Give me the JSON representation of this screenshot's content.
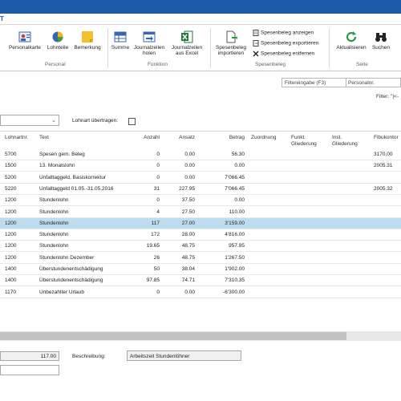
{
  "menubar": {
    "tab": "T"
  },
  "ribbon": {
    "groups": {
      "personal": "Personal",
      "funktion": "Funktion",
      "spesenbeleg": "Spesenbeleg",
      "seite": "Seite"
    },
    "buttons": {
      "personalkarte": "Personalkarte",
      "lohnteile": "Lohnteile",
      "bemerkung": "Bemerkung",
      "summe": "Summe",
      "journalzeilen_holen_1": "Journalzeilen",
      "journalzeilen_holen_2": "holen",
      "journalzeilen_excel_1": "Journalzeilen",
      "journalzeilen_excel_2": "aus Excel",
      "spesenbeleg_import_1": "Spesenbeleg",
      "spesenbeleg_import_2": "importieren",
      "spesenbeleg_anzeigen": "Spesenbeleg anzeigen",
      "spesenbeleg_exportieren": "Spesenbeleg exportieren",
      "spesenbeleg_entfernen": "Spesenbeleg entfernen",
      "aktualisieren": "Aktualisieren",
      "suchen": "Suchen"
    }
  },
  "filter": {
    "label": "Filtereingabe (F3)",
    "field": "Personalnr.",
    "status": "Filter: \"|<-"
  },
  "options": {
    "lohnart_label": "Lohnart übertragen:"
  },
  "table": {
    "headers": {
      "lohnartnr": "Lohnartnr.",
      "text": "Text",
      "anzahl": "Anzahl",
      "ansatz": "Ansatz",
      "betrag": "Betrag",
      "zuordnung": "Zuordnung",
      "funkt_1": "Funkt.",
      "funkt_2": "Gliederung",
      "inst_1": "Inst.",
      "inst_2": "Gliederung",
      "fibu": "Fibukontor"
    },
    "rows": [
      {
        "nr": "5700",
        "text": "Spesen gem. Beleg",
        "anzahl": "0",
        "ansatz": "0.00",
        "betrag": "56.30",
        "fibu": "3170.00"
      },
      {
        "nr": "1500",
        "text": "13. Monatslohn",
        "anzahl": "0",
        "ansatz": "0.00",
        "betrag": "0.00",
        "fibu": "2005.31"
      },
      {
        "nr": "5200",
        "text": "Unfalltaggeld, Basiskorrektur",
        "anzahl": "0",
        "ansatz": "0.00",
        "betrag": "7'066.45",
        "fibu": ""
      },
      {
        "nr": "5220",
        "text": "Unfalltaggeld 01.05.-31.05.2016",
        "anzahl": "31",
        "ansatz": "227.95",
        "betrag": "7'066.45",
        "fibu": "2005.32"
      },
      {
        "nr": "1200",
        "text": "Stundenlohn",
        "anzahl": "0",
        "ansatz": "37.50",
        "betrag": "0.00",
        "fibu": ""
      },
      {
        "nr": "1200",
        "text": "Stundenlohn",
        "anzahl": "4",
        "ansatz": "27.50",
        "betrag": "110.00",
        "fibu": ""
      },
      {
        "nr": "1200",
        "text": "Stundenlohn",
        "anzahl": "117",
        "ansatz": "27.00",
        "betrag": "3'159.00",
        "fibu": ""
      },
      {
        "nr": "1200",
        "text": "Stundenlohn",
        "anzahl": "172",
        "ansatz": "28.00",
        "betrag": "4'816.00",
        "fibu": ""
      },
      {
        "nr": "1200",
        "text": "Stundenlohn",
        "anzahl": "19.65",
        "ansatz": "48.75",
        "betrag": "957.95",
        "fibu": ""
      },
      {
        "nr": "1200",
        "text": "Stundenlohn Dezember",
        "anzahl": "26",
        "ansatz": "48.75",
        "betrag": "1'267.50",
        "fibu": ""
      },
      {
        "nr": "1400",
        "text": "Überstundenentschädigung",
        "anzahl": "50",
        "ansatz": "38.04",
        "betrag": "1'902.00",
        "fibu": ""
      },
      {
        "nr": "1400",
        "text": "Überstundenentschädigung",
        "anzahl": "97.85",
        "ansatz": "74.71",
        "betrag": "7'310.35",
        "fibu": ""
      },
      {
        "nr": "1170",
        "text": "Unbezahlter Urlaub",
        "anzahl": "0",
        "ansatz": "0.00",
        "betrag": "-6'300.00",
        "fibu": ""
      }
    ],
    "selected_index": 6
  },
  "footer": {
    "anzahl_value": "117.00",
    "beschreibung_label": "Beschreibung:",
    "beschreibung_value": "Arbeitszeit Stundenlöhner"
  },
  "colors": {
    "titlebar": "#1a5aa8",
    "selection": "#bcdcf0"
  }
}
